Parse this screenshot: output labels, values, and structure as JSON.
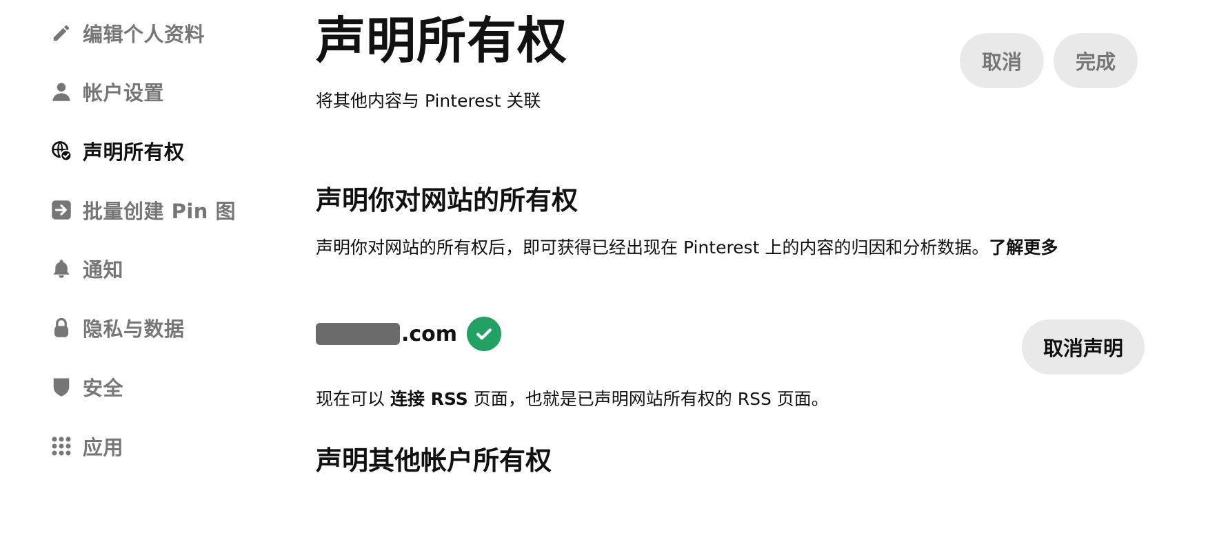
{
  "sidebar": {
    "items": [
      {
        "label": "编辑个人资料",
        "icon": "pencil-icon"
      },
      {
        "label": "帐户设置",
        "icon": "person-icon"
      },
      {
        "label": "声明所有权",
        "icon": "globe-check-icon",
        "active": true
      },
      {
        "label": "批量创建 Pin 图",
        "icon": "import-arrow-icon"
      },
      {
        "label": "通知",
        "icon": "bell-icon"
      },
      {
        "label": "隐私与数据",
        "icon": "lock-icon"
      },
      {
        "label": "安全",
        "icon": "shield-icon"
      },
      {
        "label": "应用",
        "icon": "grid-dots-icon"
      }
    ]
  },
  "header": {
    "title": "声明所有权",
    "subtitle": "将其他内容与 Pinterest 关联",
    "cancel_label": "取消",
    "done_label": "完成"
  },
  "website_section": {
    "title": "声明你对网站的所有权",
    "description": "声明你对网站的所有权后，即可获得已经出现在 Pinterest 上的内容的归因和分析数据。",
    "learn_more": "了解更多",
    "site": {
      "domain_suffix": ".com",
      "verified": true
    },
    "unclaim_label": "取消声明",
    "rss_prefix": "现在可以",
    "rss_link": "连接 RSS",
    "rss_suffix": "页面，也就是已声明网站所有权的 RSS 页面。"
  },
  "other_accounts_section": {
    "title": "声明其他帐户所有权"
  },
  "colors": {
    "text_primary": "#111111",
    "text_muted": "#767676",
    "button_bg": "#e9e9e9",
    "verified_green": "#21a163"
  }
}
